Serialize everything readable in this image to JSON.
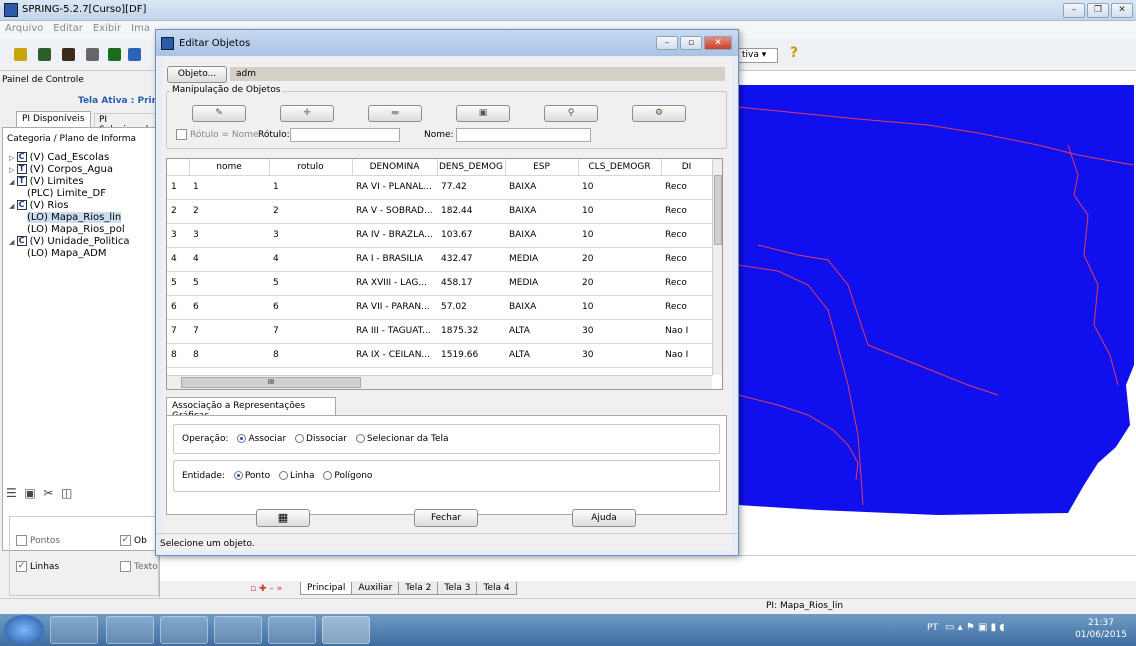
{
  "app": {
    "title": "SPRING-5.2.7[Curso][DF]"
  },
  "menu": [
    "Arquivo",
    "Editar",
    "Exibir",
    "Ima"
  ],
  "toolbar": {
    "dropdown_value": "tiva",
    "help_glyph": "?"
  },
  "panel": {
    "title": "Painel de Controle",
    "active_screen": "Tela Ativa : Prin",
    "tabs": [
      "PI Disponíveis",
      "PI Selecionad"
    ],
    "category_header": "Categoria / Plano de Informa",
    "tree": [
      {
        "type": "C",
        "label": "(V) Cad_Escolas",
        "level": 0
      },
      {
        "type": "T",
        "label": "(V) Corpos_Agua",
        "level": 0
      },
      {
        "type": "T",
        "label": "(V) Limites",
        "level": 0
      },
      {
        "type": "",
        "label": "(PLC) Limite_DF",
        "level": 1
      },
      {
        "type": "C",
        "label": "(V) Rios",
        "level": 0
      },
      {
        "type": "",
        "label": "(LO) Mapa_Rios_lin",
        "level": 1
      },
      {
        "type": "",
        "label": "(LO) Mapa_Rios_pol",
        "level": 1
      },
      {
        "type": "C",
        "label": "(V) Unidade_Politica",
        "level": 0
      },
      {
        "type": "",
        "label": "(LO) Mapa_ADM",
        "level": 1
      }
    ],
    "checks": {
      "pontos": "Pontos",
      "ob": "Ob",
      "linhas": "Linhas",
      "texto": "Texto"
    }
  },
  "dialog": {
    "title": "Editar Objetos",
    "object_button": "Objeto...",
    "object_value": "adm",
    "group_label": "Manipulação de Objetos",
    "rotulo_nome_label": "Rótulo = Nome",
    "rotulo_label": "Rótulo:",
    "nome_label": "Nome:",
    "columns": [
      "nome",
      "rotulo",
      "DENOMINA",
      "DENS_DEMOG",
      "ESP",
      "CLS_DEMOGR",
      "DI"
    ],
    "rows": [
      [
        "1",
        "1",
        "1",
        "RA VI - PLANAL...",
        "77.42",
        "BAIXA",
        "10",
        "Reco"
      ],
      [
        "2",
        "2",
        "2",
        "RA V - SOBRAD...",
        "182.44",
        "BAIXA",
        "10",
        "Reco"
      ],
      [
        "3",
        "3",
        "3",
        "RA IV - BRAZLA...",
        "103.67",
        "BAIXA",
        "10",
        "Reco"
      ],
      [
        "4",
        "4",
        "4",
        "RA I - BRASILIA",
        "432.47",
        "MEDIA",
        "20",
        "Reco"
      ],
      [
        "5",
        "5",
        "5",
        "RA XVIII - LAG...",
        "458.17",
        "MEDIA",
        "20",
        "Reco"
      ],
      [
        "6",
        "6",
        "6",
        "RA VII - PARAN...",
        "57.02",
        "BAIXA",
        "10",
        "Reco"
      ],
      [
        "7",
        "7",
        "7",
        "RA III - TAGUAT...",
        "1875.32",
        "ALTA",
        "30",
        "Nao I"
      ],
      [
        "8",
        "8",
        "8",
        "RA IX - CEILAN...",
        "1519.66",
        "ALTA",
        "30",
        "Nao I"
      ]
    ],
    "assoc_tab": "Associação a Representações Gráficas",
    "operacao_label": "Operação:",
    "operacao_options": [
      "Associar",
      "Dissociar",
      "Selecionar da Tela"
    ],
    "entidade_label": "Entidade:",
    "entidade_options": [
      "Ponto",
      "Linha",
      "Polígono"
    ],
    "fechar": "Fechar",
    "ajuda": "Ajuda",
    "status": "Selecione um objeto."
  },
  "map": {
    "fill_color": "#1010ee",
    "border_color": "#e23b5a",
    "hscroll_glyph": "III"
  },
  "screen_tabs": [
    "Principal",
    "Auxiliar",
    "Tela 2",
    "Tela 3",
    "Tela 4"
  ],
  "status_bar": "PI: Mapa_Rios_lin",
  "taskbar": {
    "lang": "PT",
    "time": "21:37",
    "date": "01/06/2015"
  }
}
